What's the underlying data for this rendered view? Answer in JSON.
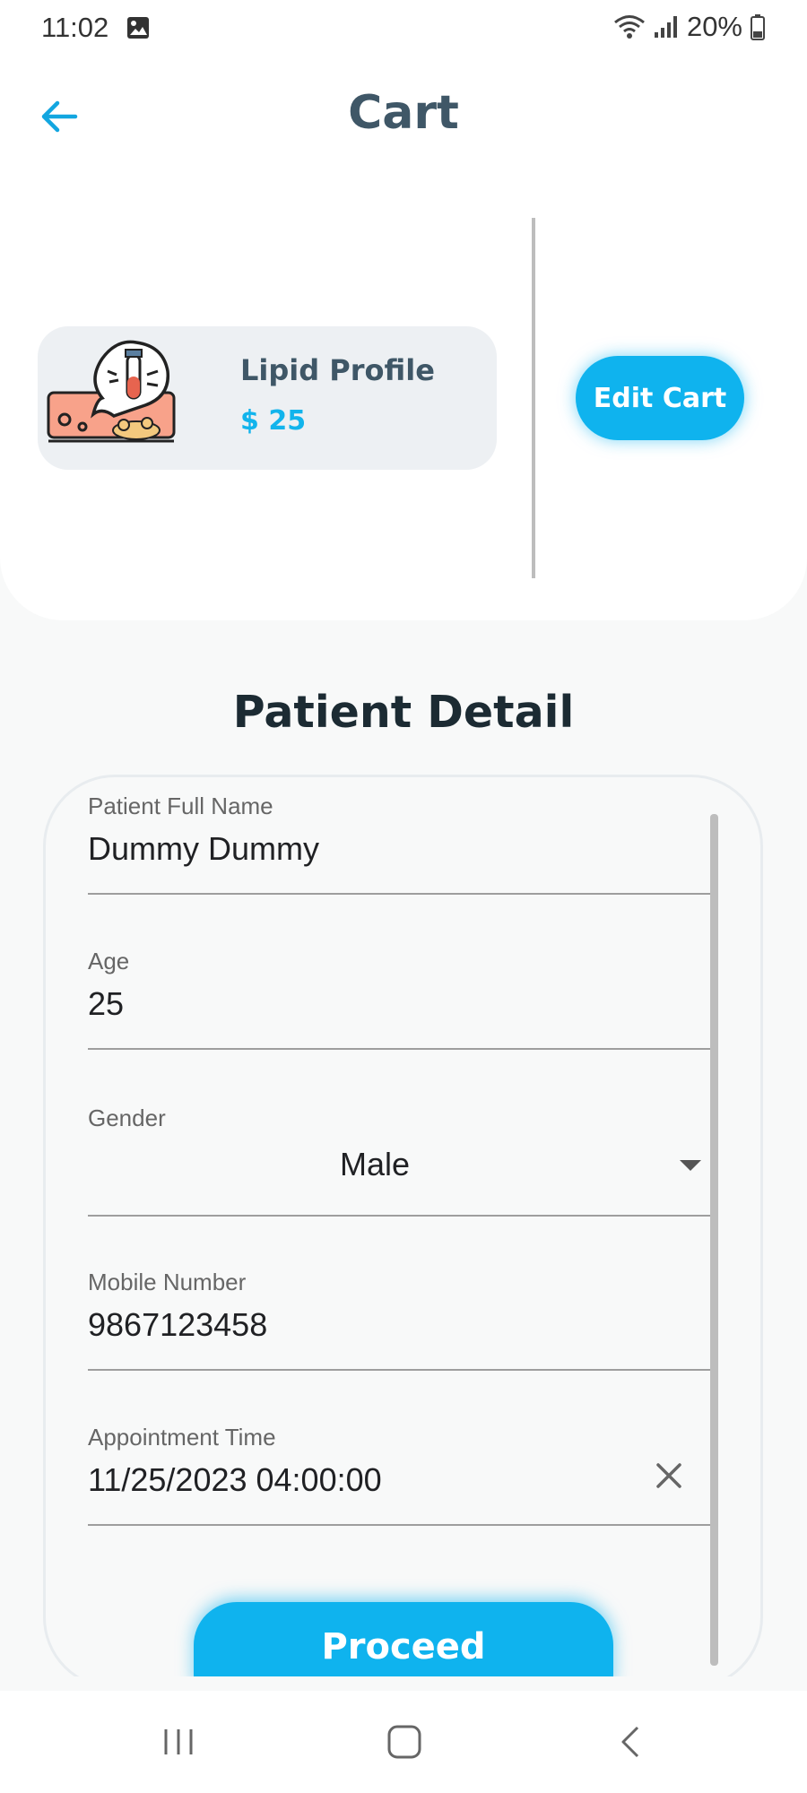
{
  "status_bar": {
    "time": "11:02",
    "battery": "20%",
    "icons": [
      "gallery-icon",
      "wifi-icon",
      "signal-icon",
      "battery-icon"
    ]
  },
  "header": {
    "title": "Cart",
    "back_icon": "arrow-left-icon"
  },
  "cart": {
    "item": {
      "name": "Lipid Profile",
      "price": "$ 25",
      "image": "lipid-test-tube-illustration"
    },
    "edit_label": "Edit Cart"
  },
  "patient_detail": {
    "title": "Patient Detail",
    "fields": {
      "name": {
        "label": "Patient Full Name",
        "value": "Dummy Dummy"
      },
      "age": {
        "label": "Age",
        "value": "25"
      },
      "gender": {
        "label": "Gender",
        "value": "Male"
      },
      "mobile": {
        "label": "Mobile Number",
        "value": "9867123458"
      },
      "appointment": {
        "label": "Appointment Time",
        "value": "11/25/2023 04:00:00"
      }
    },
    "proceed_label": "Proceed"
  },
  "colors": {
    "accent": "#0fb3ee",
    "title": "#3f5767",
    "background": "#f8f9f9"
  }
}
